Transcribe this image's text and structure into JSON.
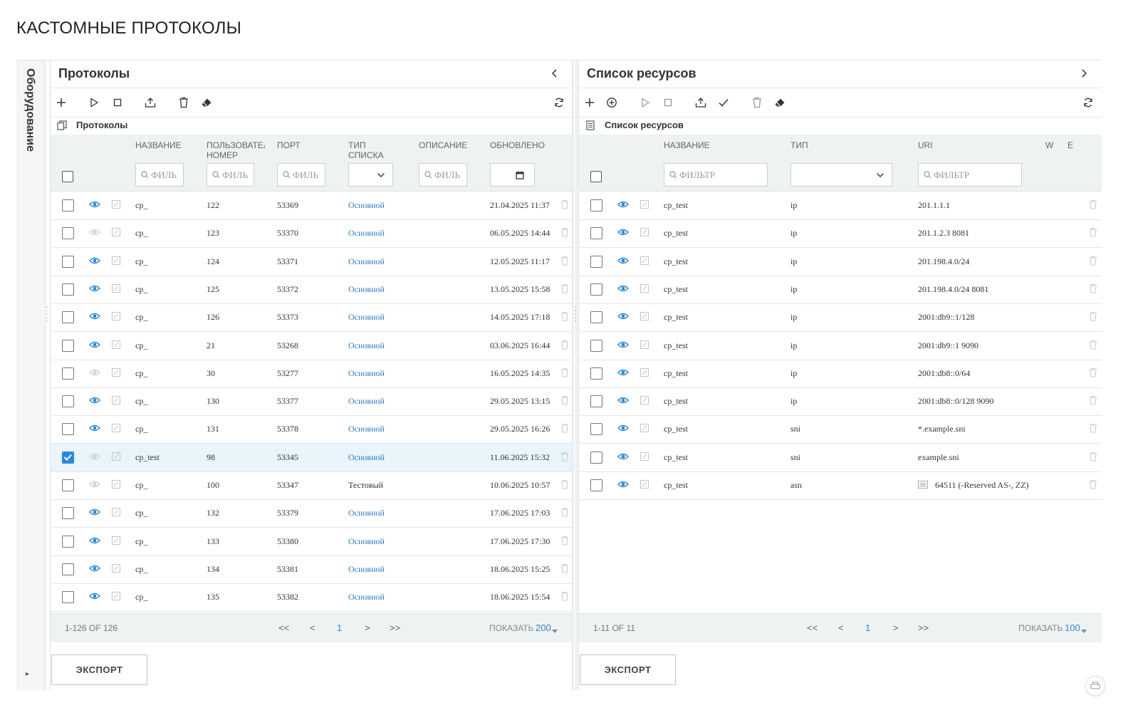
{
  "page": {
    "title": "КАСТОМНЫЕ ПРОТОКОЛЫ"
  },
  "sidebar": {
    "label": "Оборудование"
  },
  "left_panel": {
    "title": "Протоколы",
    "subheader": "Протоколы",
    "columns": [
      "НАЗВАНИЕ",
      "ПОЛЬЗОВАТЕЛ НОМЕР",
      "ПОРТ",
      "ТИП СПИСКА",
      "ОПИСАНИЕ",
      "ОБНОВЛЕНО"
    ],
    "filter_placeholder": "ФИЛЬ",
    "rows": [
      {
        "checked": false,
        "active": true,
        "name": "cp_",
        "user_num": "122",
        "port": "53369",
        "list_type": "Основной",
        "list_link": true,
        "updated": "21.04.2025 11:37"
      },
      {
        "checked": false,
        "active": false,
        "name": "cp_",
        "user_num": "123",
        "port": "53370",
        "list_type": "Основной",
        "list_link": true,
        "updated": "06.05.2025 14:44"
      },
      {
        "checked": false,
        "active": true,
        "name": "cp_",
        "user_num": "124",
        "port": "53371",
        "list_type": "Основной",
        "list_link": true,
        "updated": "12.05.2025 11:17"
      },
      {
        "checked": false,
        "active": true,
        "name": "cp_",
        "user_num": "125",
        "port": "53372",
        "list_type": "Основной",
        "list_link": true,
        "updated": "13.05.2025 15:58"
      },
      {
        "checked": false,
        "active": true,
        "name": "cp_",
        "user_num": "126",
        "port": "53373",
        "list_type": "Основной",
        "list_link": true,
        "updated": "14.05.2025 17:18"
      },
      {
        "checked": false,
        "active": true,
        "name": "cp_",
        "user_num": "21",
        "port": "53268",
        "list_type": "Основной",
        "list_link": true,
        "updated": "03.06.2025 16:44"
      },
      {
        "checked": false,
        "active": false,
        "name": "cp_",
        "user_num": "30",
        "port": "53277",
        "list_type": "Основной",
        "list_link": true,
        "updated": "16.05.2025 14:35"
      },
      {
        "checked": false,
        "active": true,
        "name": "cp_",
        "user_num": "130",
        "port": "53377",
        "list_type": "Основной",
        "list_link": true,
        "updated": "29.05.2025 13:15"
      },
      {
        "checked": false,
        "active": true,
        "name": "cp_",
        "user_num": "131",
        "port": "53378",
        "list_type": "Основной",
        "list_link": true,
        "updated": "29.05.2025 16:26"
      },
      {
        "checked": true,
        "active": false,
        "name": "cp_test",
        "user_num": "98",
        "port": "53345",
        "list_type": "Основной",
        "list_link": true,
        "updated": "11.06.2025 15:32"
      },
      {
        "checked": false,
        "active": false,
        "name": "cp_",
        "user_num": "100",
        "port": "53347",
        "list_type": "Тестовый",
        "list_link": false,
        "updated": "10.06.2025 10:57"
      },
      {
        "checked": false,
        "active": true,
        "name": "cp_",
        "user_num": "132",
        "port": "53379",
        "list_type": "Основной",
        "list_link": true,
        "updated": "17.06.2025 17:03"
      },
      {
        "checked": false,
        "active": true,
        "name": "cp_",
        "user_num": "133",
        "port": "53380",
        "list_type": "Основной",
        "list_link": true,
        "updated": "17.06.2025 17:30"
      },
      {
        "checked": false,
        "active": true,
        "name": "cp_",
        "user_num": "134",
        "port": "53381",
        "list_type": "Основной",
        "list_link": true,
        "updated": "18.06.2025 15:25"
      },
      {
        "checked": false,
        "active": true,
        "name": "cp_",
        "user_num": "135",
        "port": "53382",
        "list_type": "Основной",
        "list_link": true,
        "updated": "18.06.2025 15:54"
      }
    ],
    "footer": {
      "count": "1-126 OF 126",
      "first": "<<",
      "prev": "<",
      "page": "1",
      "next": ">",
      "last": ">>",
      "show_label": "ПОКАЗАТЬ",
      "page_size": "200"
    },
    "export_label": "ЭКСПОРТ"
  },
  "right_panel": {
    "title": "Список ресурсов",
    "subheader": "Список ресурсов",
    "columns": [
      "НАЗВАНИЕ",
      "ТИП",
      "URI",
      "W",
      "E"
    ],
    "filter_placeholder": "ФИЛЬТР",
    "rows": [
      {
        "checked": false,
        "active": true,
        "name": "cp_test",
        "type": "ip",
        "uri": "201.1.1.1"
      },
      {
        "checked": false,
        "active": true,
        "name": "cp_test",
        "type": "ip",
        "uri": "201.1.2.3 8081"
      },
      {
        "checked": false,
        "active": true,
        "name": "cp_test",
        "type": "ip",
        "uri": "201.198.4.0/24"
      },
      {
        "checked": false,
        "active": true,
        "name": "cp_test",
        "type": "ip",
        "uri": "201.198.4.0/24 8081"
      },
      {
        "checked": false,
        "active": true,
        "name": "cp_test",
        "type": "ip",
        "uri": "2001:db9::1/128"
      },
      {
        "checked": false,
        "active": true,
        "name": "cp_test",
        "type": "ip",
        "uri": "2001:db9::1 9090"
      },
      {
        "checked": false,
        "active": true,
        "name": "cp_test",
        "type": "ip",
        "uri": "2001:db8::0/64"
      },
      {
        "checked": false,
        "active": true,
        "name": "cp_test",
        "type": "ip",
        "uri": "2001:db8::0/128 9090"
      },
      {
        "checked": false,
        "active": true,
        "name": "cp_test",
        "type": "sni",
        "uri": "*.example.sni"
      },
      {
        "checked": false,
        "active": true,
        "name": "cp_test",
        "type": "sni",
        "uri": "example.sni"
      },
      {
        "checked": false,
        "active": true,
        "name": "cp_test",
        "type": "asn",
        "uri": "64511 (-Reserved AS-, ZZ)",
        "uri_icon": "list-icon"
      }
    ],
    "footer": {
      "count": "1-11 OF 11",
      "first": "<<",
      "prev": "<",
      "page": "1",
      "next": ">",
      "last": ">>",
      "show_label": "ПОКАЗАТЬ",
      "page_size": "100"
    },
    "export_label": "ЭКСПОРТ"
  },
  "colors": {
    "accent": "#2a8ad6",
    "link": "#2a7bc8",
    "header_bg": "#eef2f2",
    "selected_row": "#e9f4fb"
  }
}
